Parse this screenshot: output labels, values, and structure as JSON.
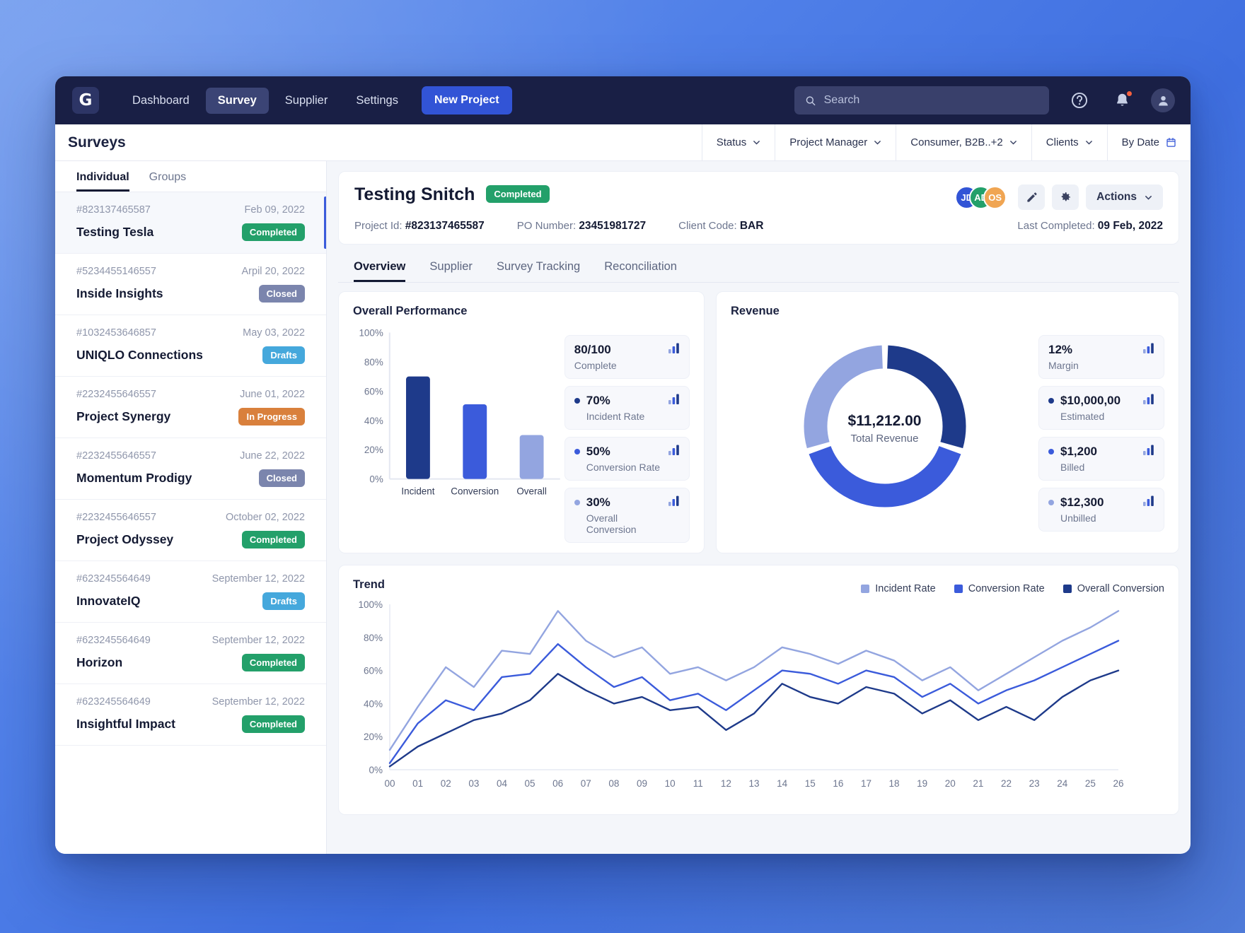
{
  "colors": {
    "navy": "#191f45",
    "accent_blue": "#3254d6",
    "dark_navy_series": "#1e3a8a",
    "mid_blue_series": "#3b5bdb",
    "light_blue_series": "#93a5e0",
    "green": "#23a06a",
    "orange": "#d9803c",
    "sky": "#45a8dc",
    "slate": "#7b85ad"
  },
  "topnav": {
    "logo": "G",
    "links": [
      {
        "label": "Dashboard",
        "active": false
      },
      {
        "label": "Survey",
        "active": true
      },
      {
        "label": "Supplier",
        "active": false
      },
      {
        "label": "Settings",
        "active": false
      }
    ],
    "new_project_label": "New Project",
    "search_placeholder": "Search",
    "icons": [
      "search-icon",
      "help-icon",
      "bell-icon",
      "user-avatar-icon"
    ]
  },
  "pagehead": {
    "title": "Surveys",
    "filters": [
      {
        "label": "Status",
        "icon": "chevron-down-icon"
      },
      {
        "label": "Project Manager",
        "icon": "chevron-down-icon"
      },
      {
        "label": "Consumer, B2B..+2",
        "icon": "chevron-down-icon"
      },
      {
        "label": "Clients",
        "icon": "chevron-down-icon"
      },
      {
        "label": "By Date",
        "icon": "calendar-icon"
      }
    ]
  },
  "sidebar": {
    "tabs": [
      {
        "label": "Individual",
        "active": true
      },
      {
        "label": "Groups",
        "active": false
      }
    ],
    "items": [
      {
        "id": "#823137465587",
        "date": "Feb 09, 2022",
        "name": "Testing Tesla",
        "status": "Completed",
        "status_class": "b-completed",
        "selected": true
      },
      {
        "id": "#5234455146557",
        "date": "Arpil 20, 2022",
        "name": "Inside Insights",
        "status": "Closed",
        "status_class": "b-closed",
        "selected": false
      },
      {
        "id": "#1032453646857",
        "date": "May 03, 2022",
        "name": "UNIQLO Connections",
        "status": "Drafts",
        "status_class": "b-drafts",
        "selected": false
      },
      {
        "id": "#2232455646557",
        "date": "June 01, 2022",
        "name": "Project Synergy",
        "status": "In Progress",
        "status_class": "b-inprogress",
        "selected": false
      },
      {
        "id": "#2232455646557",
        "date": "June 22, 2022",
        "name": "Momentum Prodigy",
        "status": "Closed",
        "status_class": "b-closed",
        "selected": false
      },
      {
        "id": "#2232455646557",
        "date": "October 02, 2022",
        "name": "Project Odyssey",
        "status": "Completed",
        "status_class": "b-completed",
        "selected": false
      },
      {
        "id": "#623245564649",
        "date": "September 12, 2022",
        "name": "InnovateIQ",
        "status": "Drafts",
        "status_class": "b-drafts",
        "selected": false
      },
      {
        "id": "#623245564649",
        "date": "September 12, 2022",
        "name": "Horizon",
        "status": "Completed",
        "status_class": "b-completed",
        "selected": false
      },
      {
        "id": "#623245564649",
        "date": "September 12, 2022",
        "name": "Insightful Impact",
        "status": "Completed",
        "status_class": "b-completed",
        "selected": false
      }
    ]
  },
  "detail": {
    "title": "Testing Snitch",
    "status": "Completed",
    "project_id_label": "Project Id:",
    "project_id": "#823137465587",
    "po_label": "PO Number:",
    "po_number": "23451981727",
    "client_label": "Client Code:",
    "client_code": "BAR",
    "last_completed_label": "Last Completed:",
    "last_completed": "09 Feb, 2022",
    "avatars": [
      {
        "initials": "JD",
        "color": "#3254d6"
      },
      {
        "initials": "AD",
        "color": "#23a06a"
      },
      {
        "initials": "OS",
        "color": "#f0a552"
      }
    ],
    "actions_label": "Actions",
    "edit_icon": "pencil-icon",
    "settings_icon": "gear-icon",
    "tabs": [
      {
        "label": "Overview",
        "active": true
      },
      {
        "label": "Supplier",
        "active": false
      },
      {
        "label": "Survey Tracking",
        "active": false
      },
      {
        "label": "Reconciliation",
        "active": false
      }
    ]
  },
  "performance": {
    "title": "Overall Performance",
    "stats": [
      {
        "value": "80/100",
        "label": "Complete",
        "dot": null,
        "icon": "bar-chart-icon"
      },
      {
        "value": "70%",
        "label": "Incident Rate",
        "dot": "#1e3a8a",
        "icon": "bar-chart-icon"
      },
      {
        "value": "50%",
        "label": "Conversion Rate",
        "dot": "#3b5bdb",
        "icon": "bar-chart-icon"
      },
      {
        "value": "30%",
        "label": "Overall Conversion",
        "dot": "#93a5e0",
        "icon": "bar-chart-icon"
      }
    ]
  },
  "revenue": {
    "title": "Revenue",
    "total": "$11,212.00",
    "total_label": "Total Revenue",
    "stats": [
      {
        "value": "12%",
        "label": "Margin",
        "dot": null,
        "icon": "bar-chart-icon"
      },
      {
        "value": "$10,000,00",
        "label": "Estimated",
        "dot": "#1e3a8a",
        "icon": "bar-chart-icon"
      },
      {
        "value": "$1,200",
        "label": "Billed",
        "dot": "#3b5bdb",
        "icon": "bar-chart-icon"
      },
      {
        "value": "$12,300",
        "label": "Unbilled",
        "dot": "#93a5e0",
        "icon": "bar-chart-icon"
      }
    ]
  },
  "trend": {
    "title": "Trend"
  },
  "chart_data": [
    {
      "type": "bar",
      "title": "Overall Performance",
      "categories": [
        "Incident",
        "Conversion",
        "Overall"
      ],
      "values": [
        70,
        51,
        30
      ],
      "colors": [
        "#1e3a8a",
        "#3b5bdb",
        "#93a5e0"
      ],
      "ylabel": "",
      "xlabel": "",
      "ylim": [
        0,
        100
      ],
      "yticks": [
        0,
        20,
        40,
        60,
        80,
        100
      ],
      "ytick_labels": [
        "0%",
        "20%",
        "40%",
        "60%",
        "80%",
        "100%"
      ],
      "grid": false,
      "legend": "none"
    },
    {
      "type": "pie",
      "title": "Revenue",
      "subtitle": "Total Revenue",
      "center_value": "$11,212.00",
      "labels": [
        "Estimated",
        "Billed",
        "Unbilled"
      ],
      "values": [
        30,
        40,
        30
      ],
      "colors": [
        "#1e3a8a",
        "#3b5bdb",
        "#93a5e0"
      ],
      "donut": true,
      "legend": "none"
    },
    {
      "type": "line",
      "title": "Trend",
      "xlabel": "",
      "ylabel": "",
      "ylim": [
        0,
        100
      ],
      "yticks": [
        0,
        20,
        40,
        60,
        80,
        100
      ],
      "ytick_labels": [
        "0%",
        "20%",
        "40%",
        "60%",
        "80%",
        "100%"
      ],
      "x": [
        "00",
        "01",
        "02",
        "03",
        "04",
        "05",
        "06",
        "07",
        "08",
        "09",
        "10",
        "11",
        "12",
        "13",
        "14",
        "15",
        "16",
        "17",
        "18",
        "19",
        "20",
        "21",
        "22",
        "23",
        "24",
        "25",
        "26"
      ],
      "grid": false,
      "legend": "top-right",
      "series": [
        {
          "name": "Incident Rate",
          "color": "#93a5e0",
          "values": [
            12,
            38,
            62,
            50,
            72,
            70,
            96,
            78,
            68,
            74,
            58,
            62,
            54,
            62,
            74,
            70,
            64,
            72,
            66,
            54,
            62,
            48,
            58,
            68,
            78,
            86,
            96
          ]
        },
        {
          "name": "Conversion Rate",
          "color": "#3b5bdb",
          "values": [
            4,
            28,
            42,
            36,
            56,
            58,
            76,
            62,
            50,
            56,
            42,
            46,
            36,
            48,
            60,
            58,
            52,
            60,
            56,
            44,
            52,
            40,
            48,
            54,
            62,
            70,
            78
          ]
        },
        {
          "name": "Overall Conversion",
          "color": "#1e3a8a",
          "values": [
            2,
            14,
            22,
            30,
            34,
            42,
            58,
            48,
            40,
            44,
            36,
            38,
            24,
            34,
            52,
            44,
            40,
            50,
            46,
            34,
            42,
            30,
            38,
            30,
            44,
            54,
            60
          ]
        }
      ]
    }
  ]
}
